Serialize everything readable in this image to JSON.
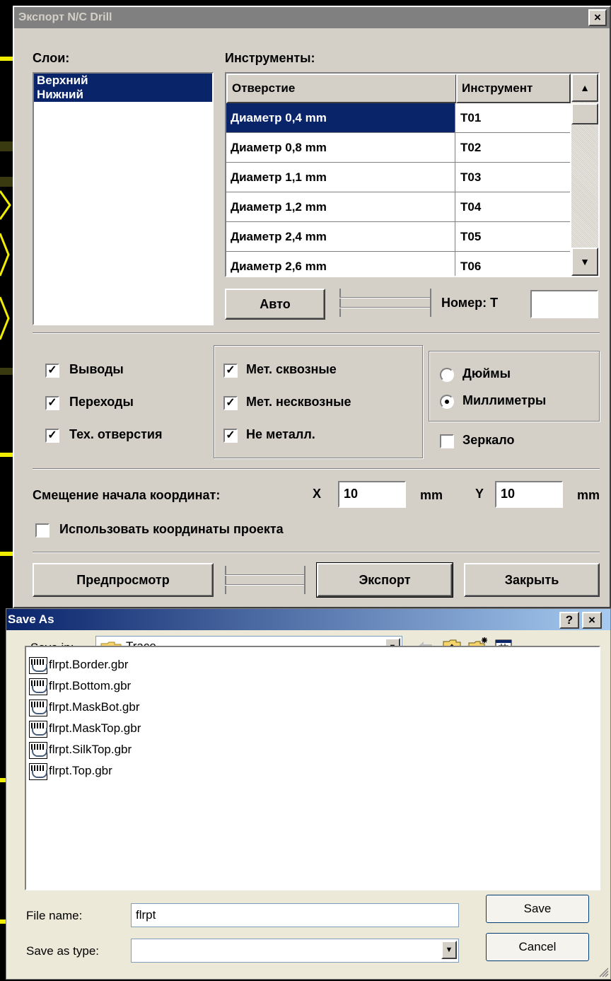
{
  "export_dialog": {
    "title": "Экспорт N/C Drill",
    "close_glyph": "×",
    "layers_label": "Слои:",
    "layers": [
      "Верхний",
      "Нижний"
    ],
    "selected_layer_index": 0,
    "tools_label": "Инструменты:",
    "tools_columns": [
      "Отверстие",
      "Инструмент"
    ],
    "tools_rows": [
      {
        "hole": "Диаметр 0,4 mm",
        "tool": "T01",
        "selected": true
      },
      {
        "hole": "Диаметр 0,8 mm",
        "tool": "T02"
      },
      {
        "hole": "Диаметр 1,1 mm",
        "tool": "T03"
      },
      {
        "hole": "Диаметр 1,2 mm",
        "tool": "T04"
      },
      {
        "hole": "Диаметр 2,4 mm",
        "tool": "T05"
      },
      {
        "hole": "Диаметр 2,6 mm",
        "tool": "T06"
      }
    ],
    "auto_button": "Авто",
    "number_label": "Номер: T",
    "number_value": "",
    "checks_left": [
      {
        "label": "Выводы",
        "checked": true
      },
      {
        "label": "Переходы",
        "checked": true
      },
      {
        "label": "Тех. отверстия",
        "checked": true
      }
    ],
    "checks_mid": [
      {
        "label": "Мет. сквозные",
        "checked": true
      },
      {
        "label": "Мет. несквозные",
        "checked": true
      },
      {
        "label": "Не металл.",
        "checked": true
      }
    ],
    "units": [
      {
        "label": "Дюймы",
        "selected": false
      },
      {
        "label": "Миллиметры",
        "selected": true
      }
    ],
    "mirror": {
      "label": "Зеркало",
      "checked": false
    },
    "offset_label": "Смещение начала координат:",
    "x_label": "X",
    "x_value": "10",
    "y_label": "Y",
    "y_value": "10",
    "unit_mm": "mm",
    "use_project_coords": {
      "label": "Использовать координаты проекта",
      "checked": false
    },
    "preview_button": "Предпросмотр",
    "export_button": "Экспорт",
    "close_button": "Закрыть"
  },
  "save_dialog": {
    "title": "Save As",
    "help_glyph": "?",
    "close_glyph": "×",
    "save_in_label": "Save in:",
    "save_in_value": "Trace",
    "files": [
      "flrpt.Border.gbr",
      "flrpt.Bottom.gbr",
      "flrpt.MaskBot.gbr",
      "flrpt.MaskTop.gbr",
      "flrpt.SilkTop.gbr",
      "flrpt.Top.gbr"
    ],
    "file_name_label": "File name:",
    "file_name_value": "flrpt",
    "save_type_label": "Save as type:",
    "save_type_value": "",
    "save_button": "Save",
    "cancel_button": "Cancel"
  },
  "colors": {
    "dialog_face": "#d4d0c8",
    "selection": "#0a246a",
    "title_inactive": "#808080",
    "pcb_trace": "#f0ec00",
    "pcb_track_dark": "#3a3a10"
  }
}
